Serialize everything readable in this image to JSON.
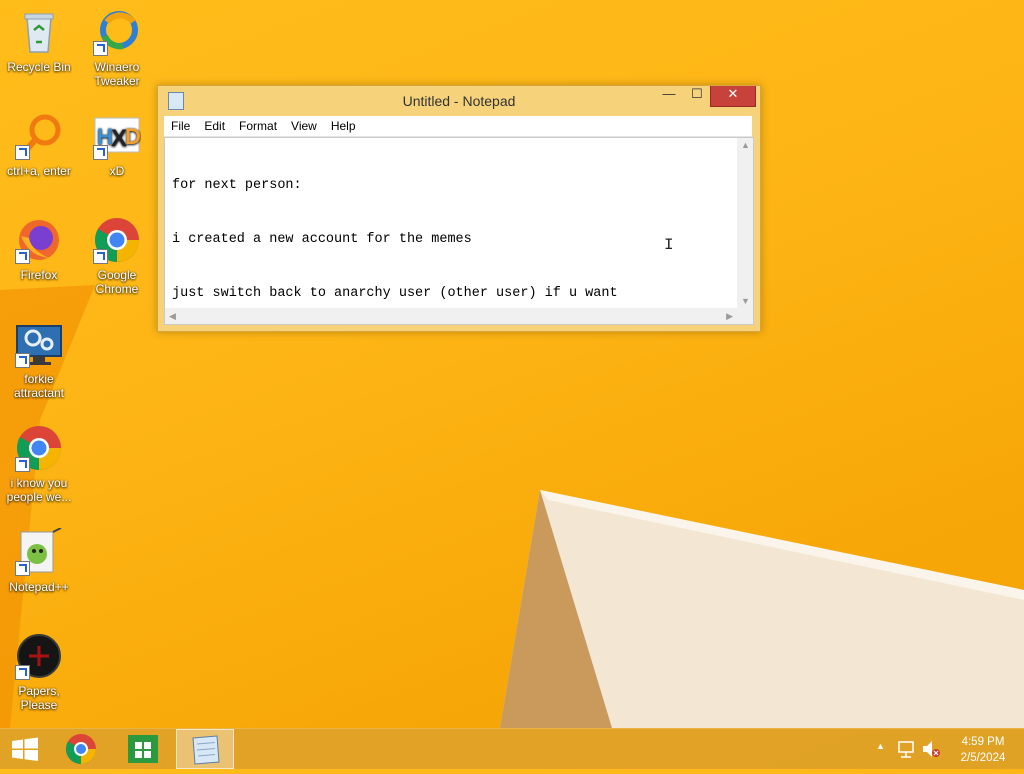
{
  "desktop": {
    "icons": [
      {
        "label": "Recycle Bin"
      },
      {
        "label": "Winaero Tweaker"
      },
      {
        "label": "ctrl+a, enter"
      },
      {
        "label": "xD"
      },
      {
        "label": "Firefox"
      },
      {
        "label": "Google Chrome"
      },
      {
        "label": "forkie attractant"
      },
      {
        "label": "i know you people we..."
      },
      {
        "label": "Notepad++"
      },
      {
        "label": "Papers, Please"
      }
    ]
  },
  "notepad": {
    "title": "Untitled - Notepad",
    "menu": [
      "File",
      "Edit",
      "Format",
      "View",
      "Help"
    ],
    "lines": [
      "for next person:",
      "i created a new account for the memes",
      "just switch back to anarchy user (other user) if u want"
    ],
    "min_glyph": "—",
    "max_glyph": "☐",
    "close_glyph": "✕"
  },
  "taskbar": {
    "time": "4:59 PM",
    "date": "2/5/2024"
  },
  "colors": {
    "wallpaper": "#fdb515",
    "close_button": "#c7423a",
    "taskbar": "#dea228"
  }
}
